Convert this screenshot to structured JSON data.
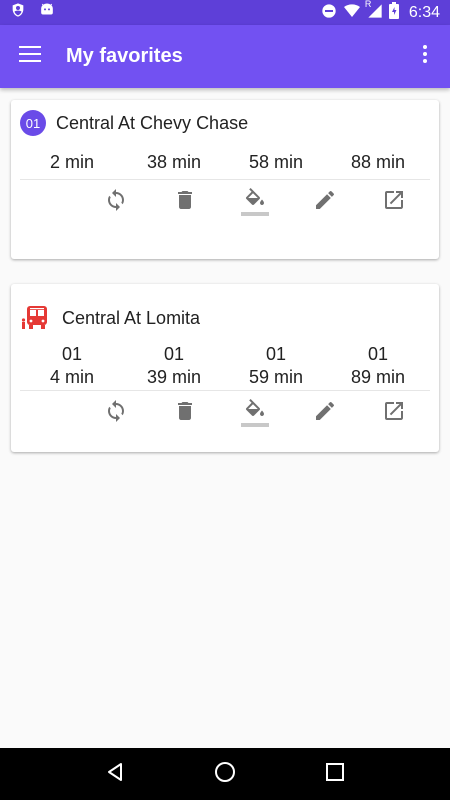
{
  "status_bar": {
    "time": "6:34",
    "signal_label": "R",
    "icons": [
      "shield-icon",
      "android-icon",
      "do-not-disturb-icon",
      "wifi-icon",
      "signal-icon",
      "battery-icon"
    ]
  },
  "app_bar": {
    "title": "My favorites",
    "background": "#7251f2",
    "status_background": "#5e3fd8"
  },
  "favorites": [
    {
      "route_badge": "01",
      "stop_name": "Central At Chevy Chase",
      "times": [
        "2 min",
        "38 min",
        "58 min",
        "88 min"
      ]
    },
    {
      "stop_name": "Central At Lomita",
      "times": [
        {
          "route": "01",
          "eta": "4 min"
        },
        {
          "route": "01",
          "eta": "39 min"
        },
        {
          "route": "01",
          "eta": "59 min"
        },
        {
          "route": "01",
          "eta": "89 min"
        }
      ]
    }
  ],
  "actions": [
    "refresh-icon",
    "delete-icon",
    "color-fill-icon",
    "edit-icon",
    "open-in-new-icon"
  ],
  "colors": {
    "accent": "#6a4be8",
    "bus_icon": "#e53935",
    "icon_gray": "#707070"
  },
  "nav_bar": [
    "back-icon",
    "home-icon",
    "recents-icon"
  ]
}
